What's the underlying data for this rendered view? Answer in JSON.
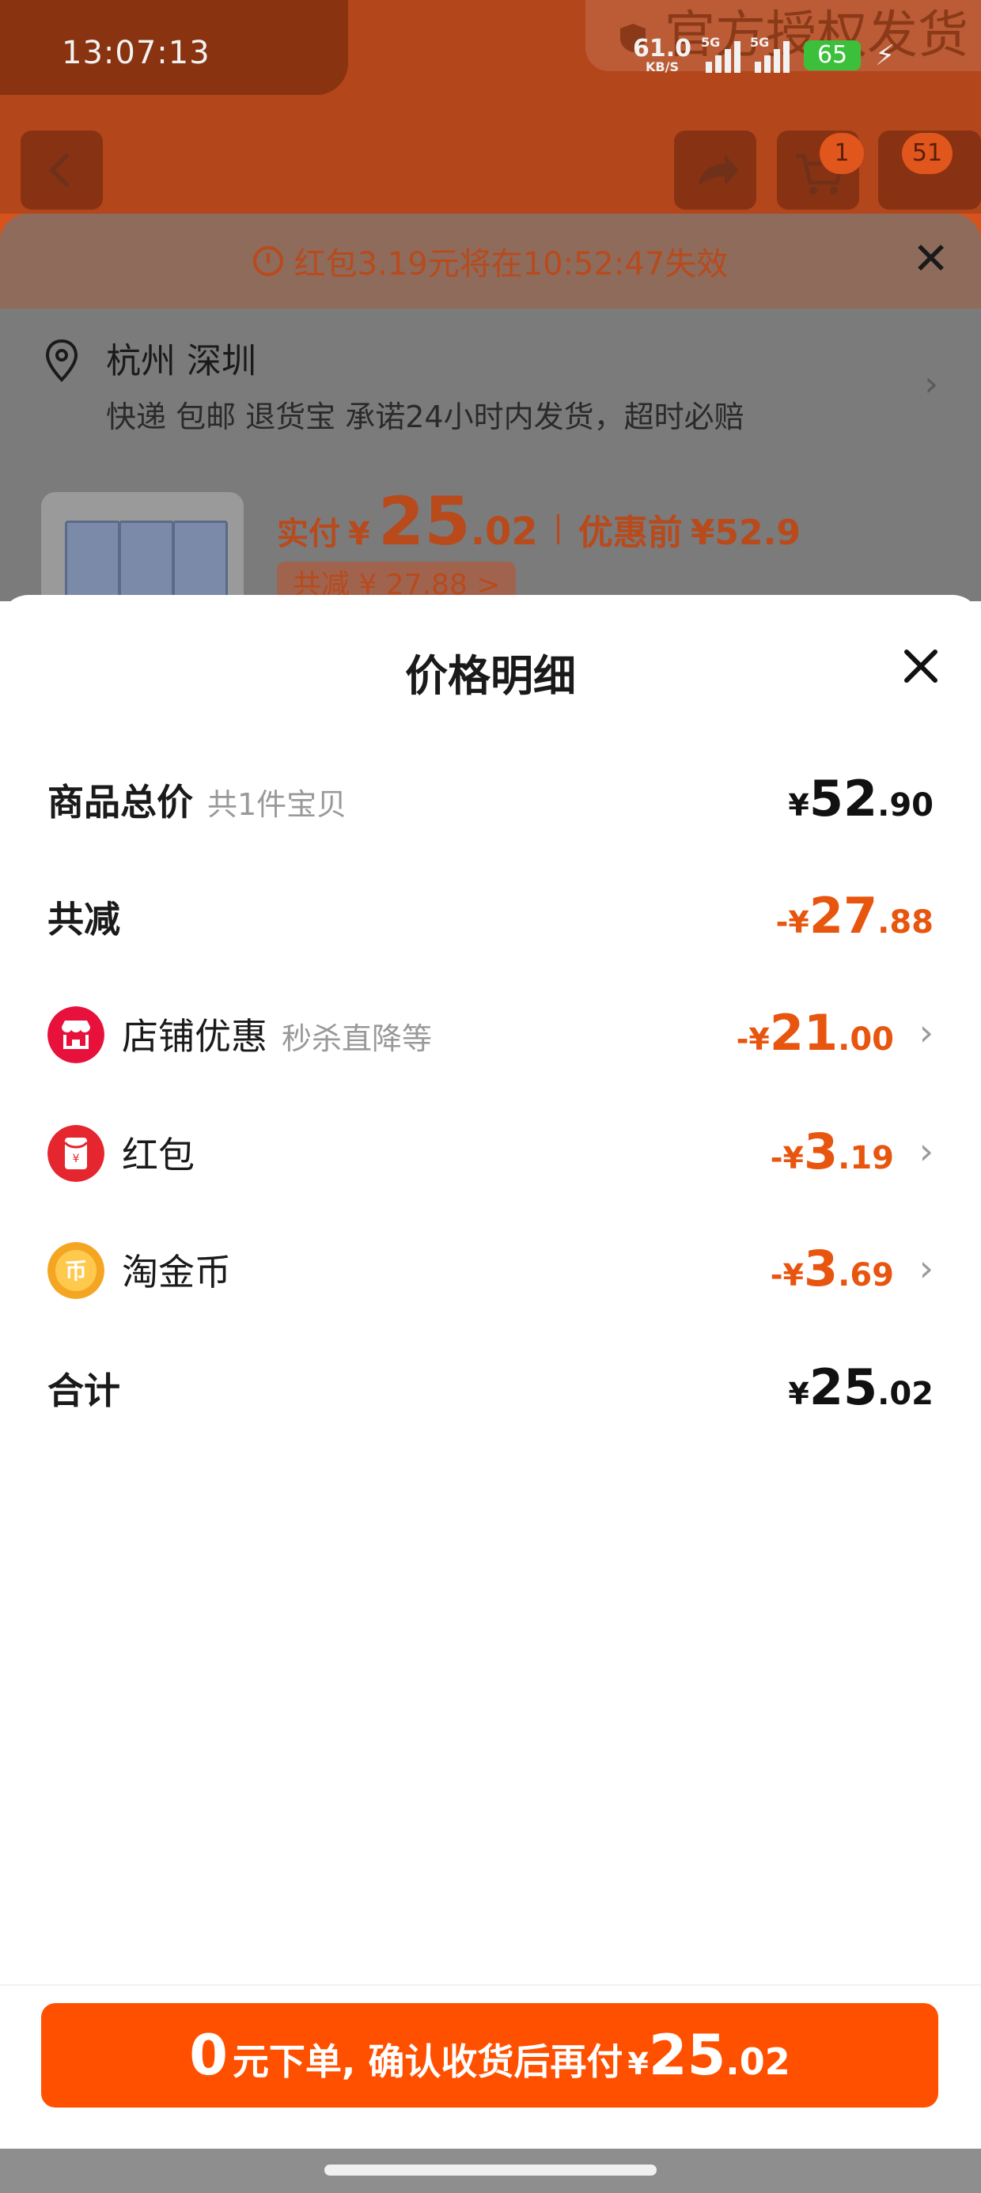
{
  "status_bar": {
    "time": "13:07:13",
    "net_speed": "61.0",
    "net_unit": "KB/S",
    "signal1_tag": "5G",
    "signal2_tag": "5G",
    "battery": "65"
  },
  "background": {
    "watermark_text": "官方授权发货",
    "cart_badge": "1",
    "msg_badge": "51",
    "red_packet_notice": "红包3.19元将在10:52:47失效",
    "address_city": "杭州 深圳",
    "address_desc": "快递 包邮 退货宝 承诺24小时内发货，超时必赔",
    "price": {
      "label": "实付",
      "currency": "¥",
      "integer": "25",
      "decimal": ".02",
      "before_label": "优惠前",
      "before_value": "¥52.9",
      "saved": "共减 ¥ 27.88 >"
    }
  },
  "sheet": {
    "title": "价格明细",
    "rows": [
      {
        "label": "商品总价",
        "sub": "共1件宝贝",
        "currency": "¥",
        "integer": "52",
        "decimal": ".90"
      },
      {
        "label": "共减",
        "sign": "-",
        "currency": "¥",
        "integer": "27",
        "decimal": ".88"
      },
      {
        "label": "店铺优惠",
        "sub": "秒杀直降等",
        "sign": "-",
        "currency": "¥",
        "integer": "21",
        "decimal": ".00",
        "icon": "store-icon"
      },
      {
        "label": "红包",
        "sign": "-",
        "currency": "¥",
        "integer": "3",
        "decimal": ".19",
        "icon": "red-packet-icon"
      },
      {
        "label": "淘金币",
        "sign": "-",
        "currency": "¥",
        "integer": "3",
        "decimal": ".69",
        "icon": "coin-icon"
      },
      {
        "label": "合计",
        "currency": "¥",
        "integer": "25",
        "decimal": ".02"
      }
    ]
  },
  "footer": {
    "zero": "0",
    "text": "元下单, 确认收货后再付",
    "currency": "¥",
    "integer": "25",
    "decimal": ".02"
  },
  "colors": {
    "accent": "#ff5000",
    "discount": "#e8550f",
    "shop_icon": "#e8113c",
    "red_packet_icon": "#e6262e",
    "coin_icon": "#f4a623"
  }
}
